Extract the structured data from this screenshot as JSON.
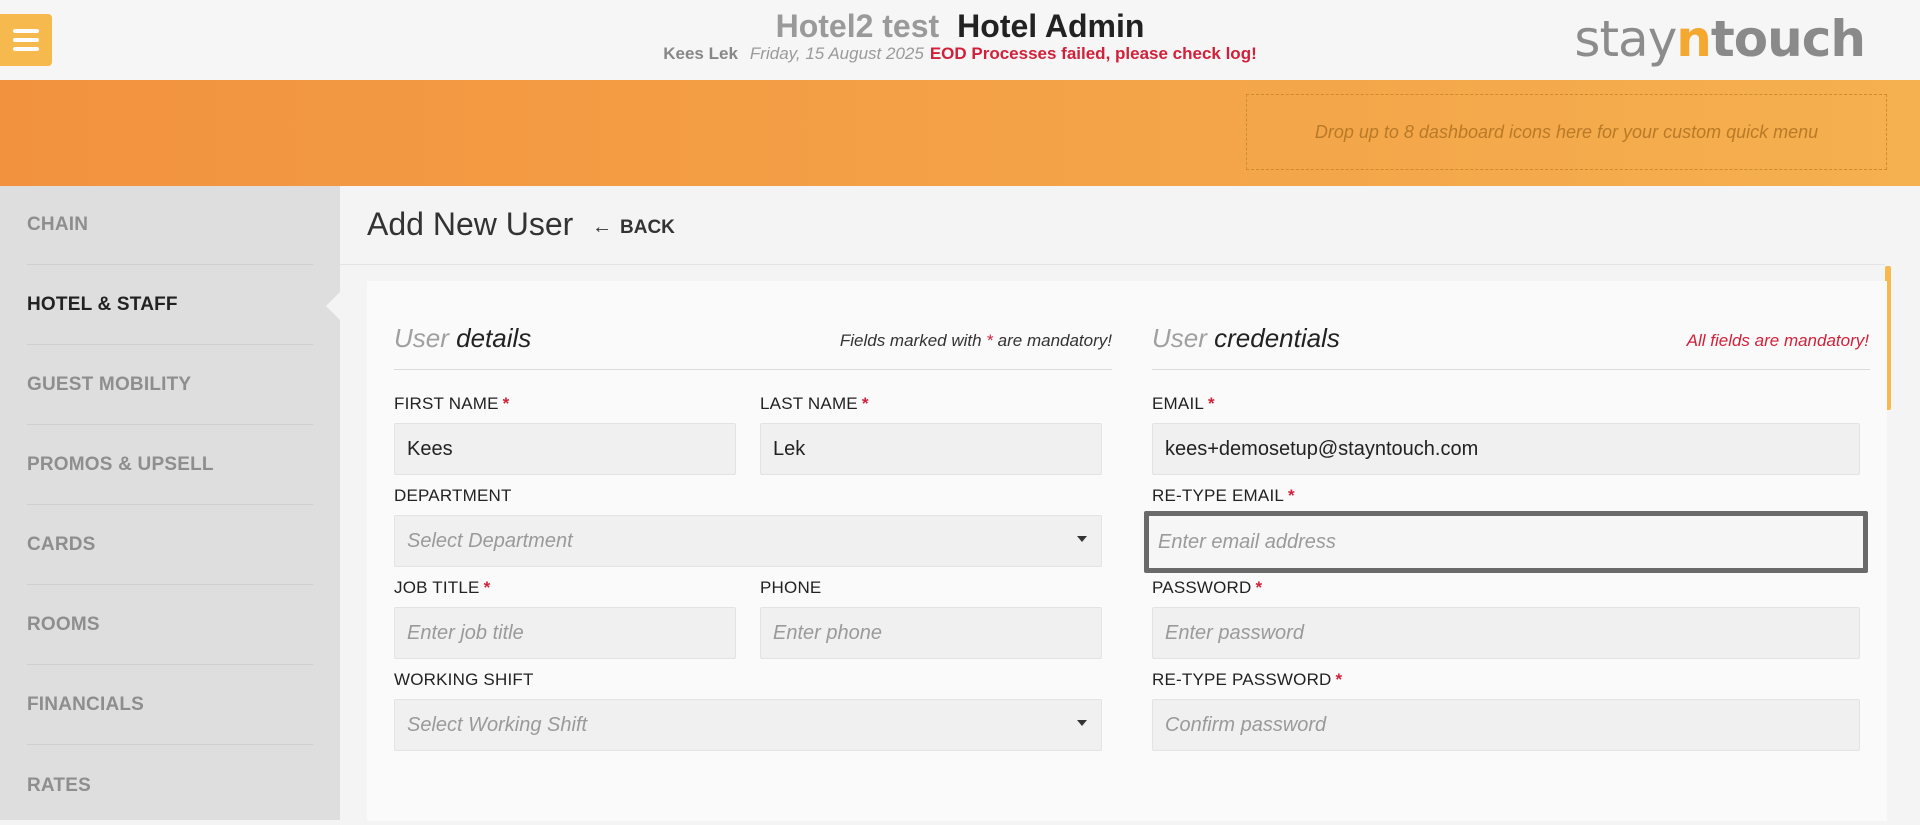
{
  "header": {
    "hotel_name": "Hotel2 test",
    "app_title": "Hotel Admin",
    "user_name": "Kees Lek",
    "date": "Friday, 15 August 2025",
    "error_message": "EOD Processes failed, please check log!",
    "logo_prefix": "stay",
    "logo_n": "n",
    "logo_suffix": "touch"
  },
  "quick_menu": {
    "dropzone_text": "Drop up to 8 dashboard icons here for your custom quick menu"
  },
  "sidebar": {
    "items": [
      {
        "label": "CHAIN"
      },
      {
        "label": "HOTEL & STAFF"
      },
      {
        "label": "GUEST MOBILITY"
      },
      {
        "label": "PROMOS & UPSELL"
      },
      {
        "label": "CARDS"
      },
      {
        "label": "ROOMS"
      },
      {
        "label": "FINANCIALS"
      },
      {
        "label": "RATES"
      }
    ]
  },
  "page": {
    "title": "Add New User",
    "back_label": "BACK"
  },
  "user_details": {
    "title_prefix": "User",
    "title_main": "details",
    "note_before": "Fields marked with",
    "note_star": "*",
    "note_after": "are mandatory!",
    "first_name_label": "FIRST NAME",
    "first_name_value": "Kees",
    "last_name_label": "LAST NAME",
    "last_name_value": "Lek",
    "department_label": "DEPARTMENT",
    "department_placeholder": "Select Department",
    "job_title_label": "JOB TITLE",
    "job_title_placeholder": "Enter job title",
    "phone_label": "PHONE",
    "phone_placeholder": "Enter phone",
    "working_shift_label": "WORKING SHIFT",
    "working_shift_placeholder": "Select Working Shift"
  },
  "user_credentials": {
    "title_prefix": "User",
    "title_main": "credentials",
    "note": "All fields are mandatory!",
    "email_label": "EMAIL",
    "email_value": "kees+demosetup@stayntouch.com",
    "retype_email_label": "RE-TYPE EMAIL",
    "retype_email_placeholder": "Enter email address",
    "password_label": "PASSWORD",
    "password_placeholder": "Enter password",
    "retype_password_label": "RE-TYPE PASSWORD",
    "retype_password_placeholder": "Confirm password"
  },
  "required_star": "*",
  "colors": {
    "accent": "#f5b94e",
    "error": "#d1213a",
    "band_start": "#f2923f",
    "band_end": "#f5b04f"
  }
}
